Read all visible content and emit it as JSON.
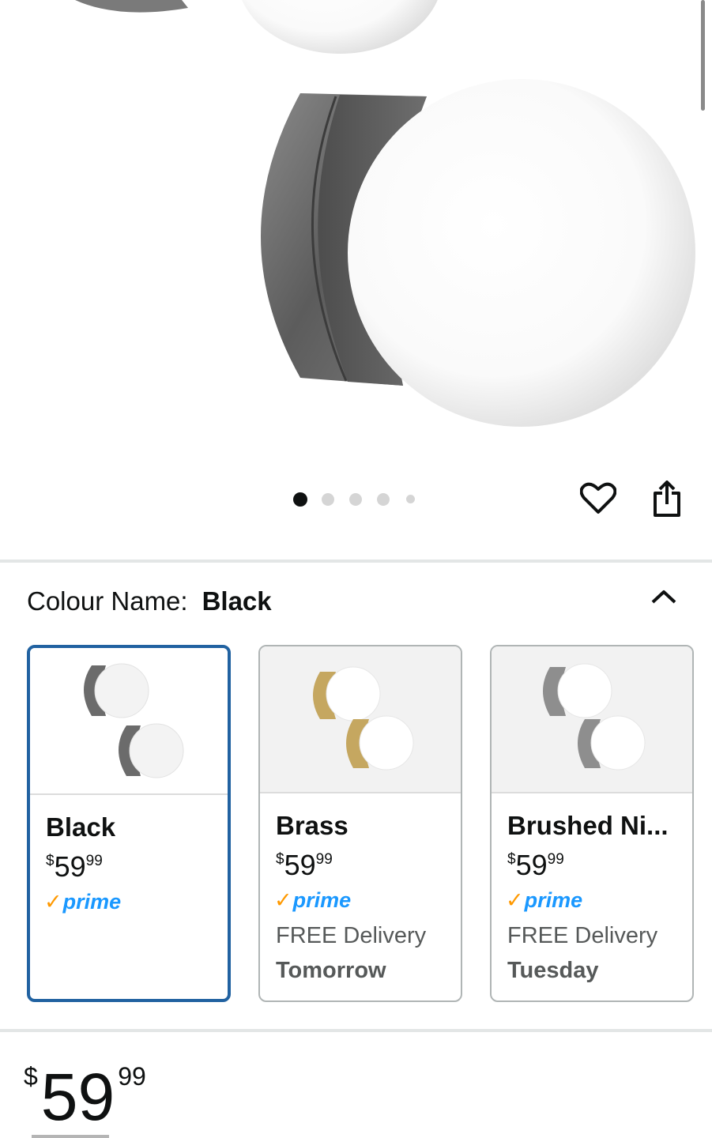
{
  "gallery": {
    "dot_count": 5,
    "active_index": 0,
    "wishlist_icon": "heart-icon",
    "share_icon": "share-icon"
  },
  "variant": {
    "label": "Colour Name:",
    "selected": "Black",
    "collapse_icon": "chevron-up-icon"
  },
  "options": [
    {
      "name": "Black",
      "price_currency": "$",
      "price_whole": "59",
      "price_fraction": "99",
      "prime_check": "✓",
      "prime": "prime",
      "delivery_line1": "",
      "delivery_line2": "",
      "finish_color": "#6b6b6b"
    },
    {
      "name": "Brass",
      "price_currency": "$",
      "price_whole": "59",
      "price_fraction": "99",
      "prime_check": "✓",
      "prime": "prime",
      "delivery_line1": "FREE Delivery",
      "delivery_line2": "Tomorrow",
      "finish_color": "#c5a760"
    },
    {
      "name": "Brushed Ni...",
      "price_currency": "$",
      "price_whole": "59",
      "price_fraction": "99",
      "prime_check": "✓",
      "prime": "prime",
      "delivery_line1": "FREE Delivery",
      "delivery_line2": "Tuesday",
      "finish_color": "#8e8e8e"
    }
  ],
  "price": {
    "currency": "$",
    "whole": "59",
    "fraction": "99"
  },
  "colors": {
    "selected_border": "#2162a1",
    "prime_blue": "#1a98ff",
    "prime_check": "#ff9900"
  }
}
